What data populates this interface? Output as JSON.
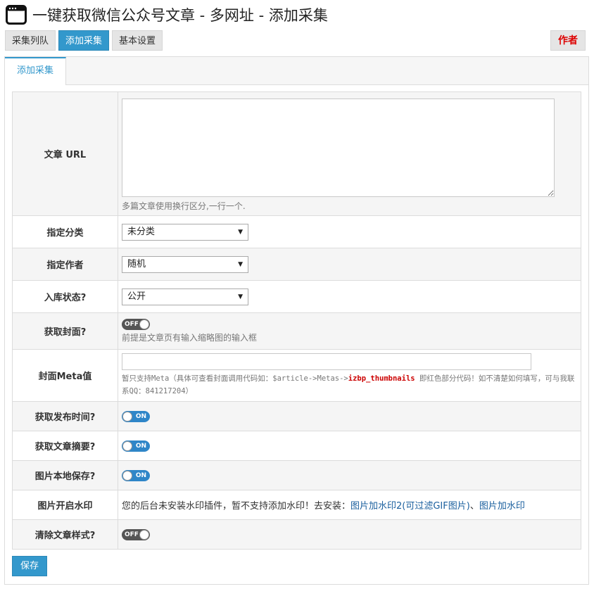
{
  "window": {
    "title": "一键获取微信公众号文章 - 多网址 - 添加采集",
    "icon": "window-icon"
  },
  "top_tabs": [
    {
      "label": "采集列队",
      "active": false
    },
    {
      "label": "添加采集",
      "active": true
    },
    {
      "label": "基本设置",
      "active": false
    }
  ],
  "author_button": "作者",
  "sub_tab": "添加采集",
  "form": {
    "url": {
      "label": "文章 URL",
      "value": "",
      "help": "多篇文章使用换行区分,一行一个."
    },
    "category": {
      "label": "指定分类",
      "selected": "未分类"
    },
    "author": {
      "label": "指定作者",
      "selected": "随机"
    },
    "status": {
      "label": "入库状态?",
      "selected": "公开"
    },
    "cover": {
      "label": "获取封面?",
      "toggle": "OFF",
      "help": "前提是文章页有输入缩略图的输入框"
    },
    "cover_meta": {
      "label": "封面Meta值",
      "value": "",
      "help_prefix": "暂只支持Meta（具体可查看封面调用代码如：$article->Metas->",
      "help_highlight": "izbp_thumbnails",
      "help_suffix": " 即红色部分代码！如不清楚如何填写，可与我联系QQ：841217204）"
    },
    "publish_time": {
      "label": "获取发布时间?",
      "toggle": "ON"
    },
    "summary": {
      "label": "获取文章摘要?",
      "toggle": "ON"
    },
    "local_images": {
      "label": "图片本地保存?",
      "toggle": "ON"
    },
    "watermark": {
      "label": "图片开启水印",
      "text": "您的后台未安装水印插件，暂不支持添加水印！去安装：",
      "link1": "图片加水印2(可过滤GIF图片)",
      "separator": "、",
      "link2": "图片加水印"
    },
    "clear_style": {
      "label": "清除文章样式?",
      "toggle": "OFF"
    }
  },
  "save_button": "保存",
  "colors": {
    "accent": "#3398cc",
    "author": "#dd0000",
    "toggle_on": "#2f86c8",
    "toggle_off": "#555555",
    "highlight": "#cc0000"
  }
}
